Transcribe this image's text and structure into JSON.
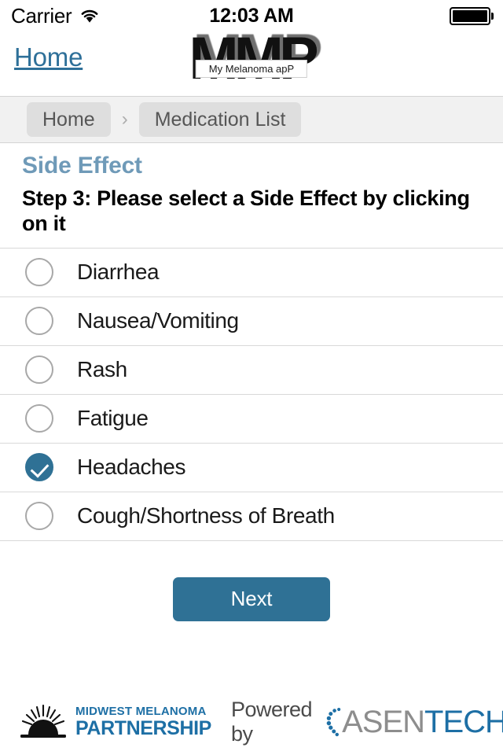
{
  "status_bar": {
    "carrier": "Carrier",
    "wifi_icon": "wifi-icon",
    "time": "12:03 AM",
    "battery_icon": "battery-full-icon"
  },
  "header": {
    "home_link": "Home",
    "logo_text": "MMP",
    "logo_tagline": "My Melanoma apP"
  },
  "breadcrumb": {
    "items": [
      {
        "label": "Home"
      },
      {
        "label": "Medication List"
      }
    ],
    "separator": "›"
  },
  "section": {
    "title": "Side Effect",
    "step_instruction": "Step 3: Please select a Side Effect by clicking on it"
  },
  "options": [
    {
      "label": "Diarrhea",
      "selected": false
    },
    {
      "label": "Nausea/Vomiting",
      "selected": false
    },
    {
      "label": "Rash",
      "selected": false
    },
    {
      "label": "Fatigue",
      "selected": false
    },
    {
      "label": "Headaches",
      "selected": true
    },
    {
      "label": "Cough/Shortness of Breath",
      "selected": false
    }
  ],
  "actions": {
    "next_label": "Next"
  },
  "footer": {
    "partner_logo": {
      "icon": "sunrise-icon",
      "line1": "MIDWEST MELANOMA",
      "line2": "PARTNERSHIP"
    },
    "powered_by": {
      "prefix": "Powered by",
      "icon": "asentech-dots-icon",
      "name_part1": "ASEN",
      "name_part2": "TECH"
    }
  },
  "colors": {
    "accent_blue": "#2f7195",
    "section_title_blue": "#6f9ab8",
    "link_blue": "#2e7099",
    "brand_blue": "#1d6fa5",
    "crumb_bar_bg": "#f1f1f1",
    "crumb_pill_bg": "#dedede",
    "separator": "#d9d9d9"
  }
}
